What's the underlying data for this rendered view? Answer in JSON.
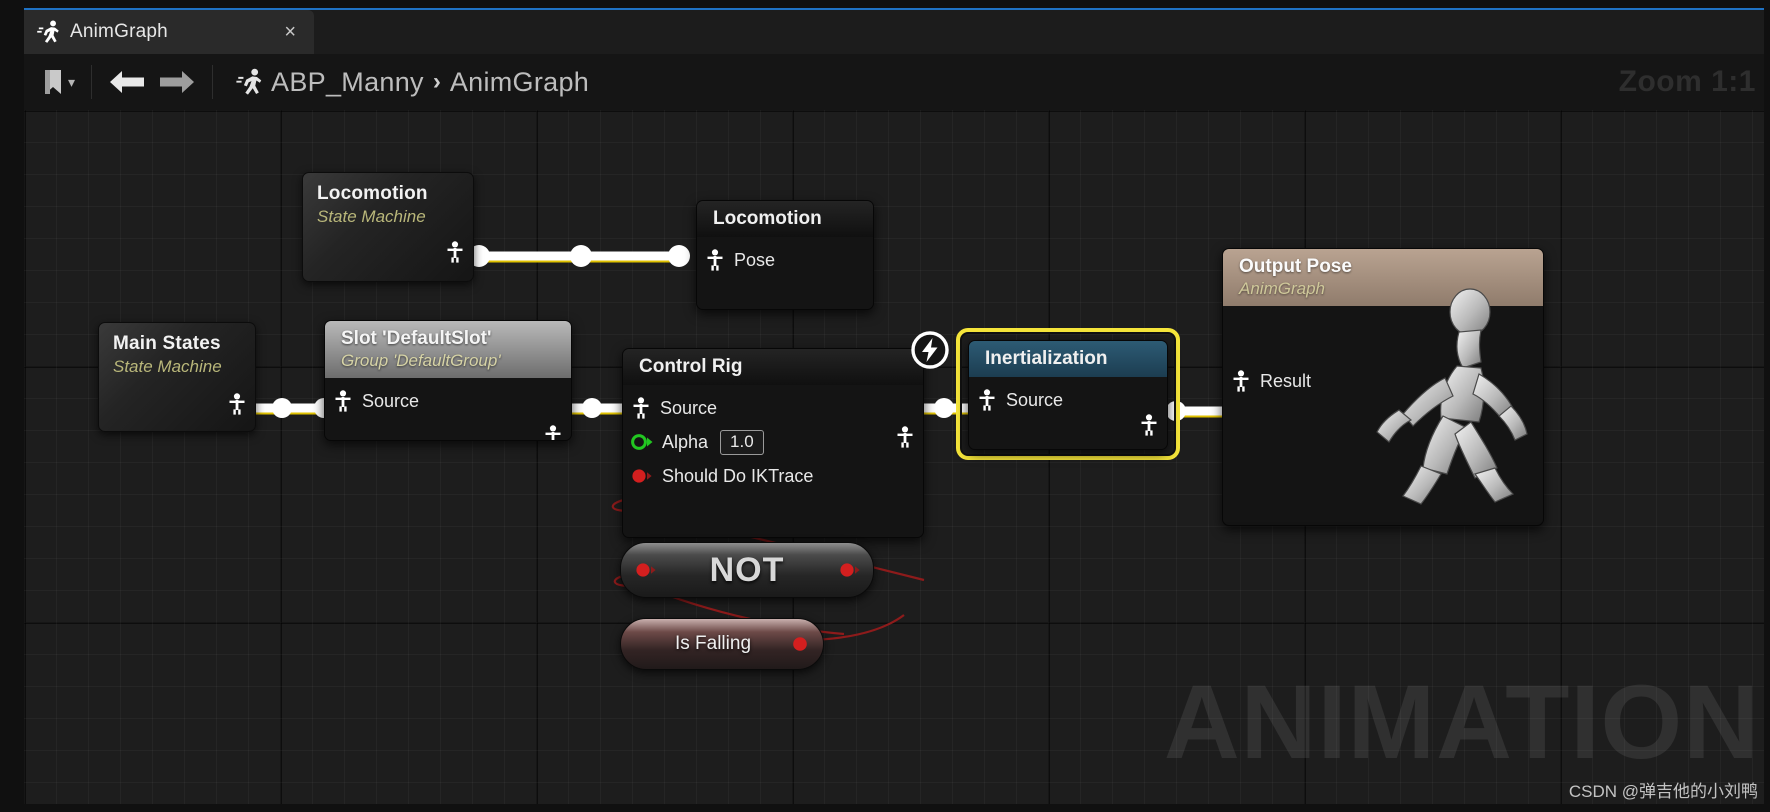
{
  "window": {
    "tab": {
      "title": "AnimGraph",
      "icon": "running-man-icon",
      "close": "×"
    }
  },
  "toolbar": {
    "bookmark_icon": "bookmark-icon",
    "bookmark_chevron": "▾",
    "back_icon": "arrow-left-icon",
    "forward_icon": "arrow-right-icon",
    "breadcrumb_icon": "running-man-icon",
    "breadcrumb": {
      "root": "ABP_Manny",
      "separator": "›",
      "leaf": "AnimGraph"
    },
    "zoom_label": "Zoom 1:1"
  },
  "canvas": {
    "watermark": "ANIMATION",
    "credit": "CSDN @弹吉他的小刘鸭"
  },
  "nodes": {
    "locomotion_sm": {
      "title": "Locomotion",
      "subtitle": "State Machine"
    },
    "locomotion_out": {
      "title": "Locomotion",
      "pins": [
        {
          "label": "Pose",
          "type": "pose"
        }
      ]
    },
    "main_states": {
      "title": "Main States",
      "subtitle": "State Machine"
    },
    "slot": {
      "title": "Slot 'DefaultSlot'",
      "subtitle": "Group 'DefaultGroup'",
      "pins": [
        {
          "label": "Source",
          "type": "pose"
        }
      ]
    },
    "control_rig": {
      "title": "Control Rig",
      "badge": "lightning-bolt-icon",
      "pins": [
        {
          "label": "Source",
          "type": "pose"
        },
        {
          "label": "Alpha",
          "type": "float",
          "value": "1.0"
        },
        {
          "label": "Should Do IKTrace",
          "type": "bool"
        }
      ]
    },
    "inertialization": {
      "title": "Inertialization",
      "selected": true,
      "pins": [
        {
          "label": "Source",
          "type": "pose"
        }
      ]
    },
    "output_pose": {
      "title": "Output Pose",
      "subtitle": "AnimGraph",
      "pins": [
        {
          "label": "Result",
          "type": "pose"
        }
      ]
    },
    "not_node": {
      "title": "NOT"
    },
    "is_falling": {
      "title": "Is Falling"
    }
  },
  "colors": {
    "selection": "#f5e53a",
    "pose_wire": "#ffffff",
    "data_wire": "#e0c200",
    "bool_wire": "#8e1b1b",
    "bool_pin": "#d41f1f",
    "float_pin": "#22c721",
    "teal_header": "#2d5b74",
    "tan_header": "#b9a391",
    "accent_tab": "#1f72c4"
  }
}
